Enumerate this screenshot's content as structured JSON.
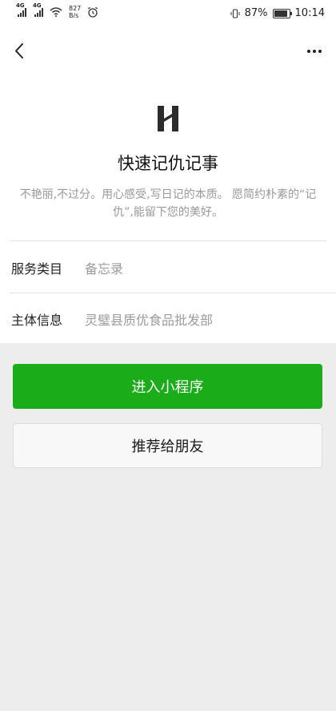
{
  "status_bar": {
    "net_label_1": "4G",
    "net_label_2": "4G",
    "net_speed": "827",
    "net_speed_unit": "B/s",
    "battery": "87%",
    "battery_level": 0.87,
    "time": "10:14"
  },
  "profile": {
    "app_name": "快速记仇记事",
    "description": "不艳丽,不过分。用心感受,写日记的本质。 愿简约朴素的“记仇”,能留下您的美好。"
  },
  "info": {
    "rows": [
      {
        "label": "服务类目",
        "value": "备忘录"
      },
      {
        "label": "主体信息",
        "value": "灵璧县质优食品批发部"
      }
    ]
  },
  "buttons": {
    "enter": "进入小程序",
    "recommend": "推荐给朋友"
  },
  "icons": {
    "back": "chevron-left-icon",
    "more": "more-dots-icon",
    "logo": "app-logo"
  },
  "colors": {
    "primary": "#1aad19",
    "background": "#ededed",
    "secondary_text": "#999999"
  }
}
